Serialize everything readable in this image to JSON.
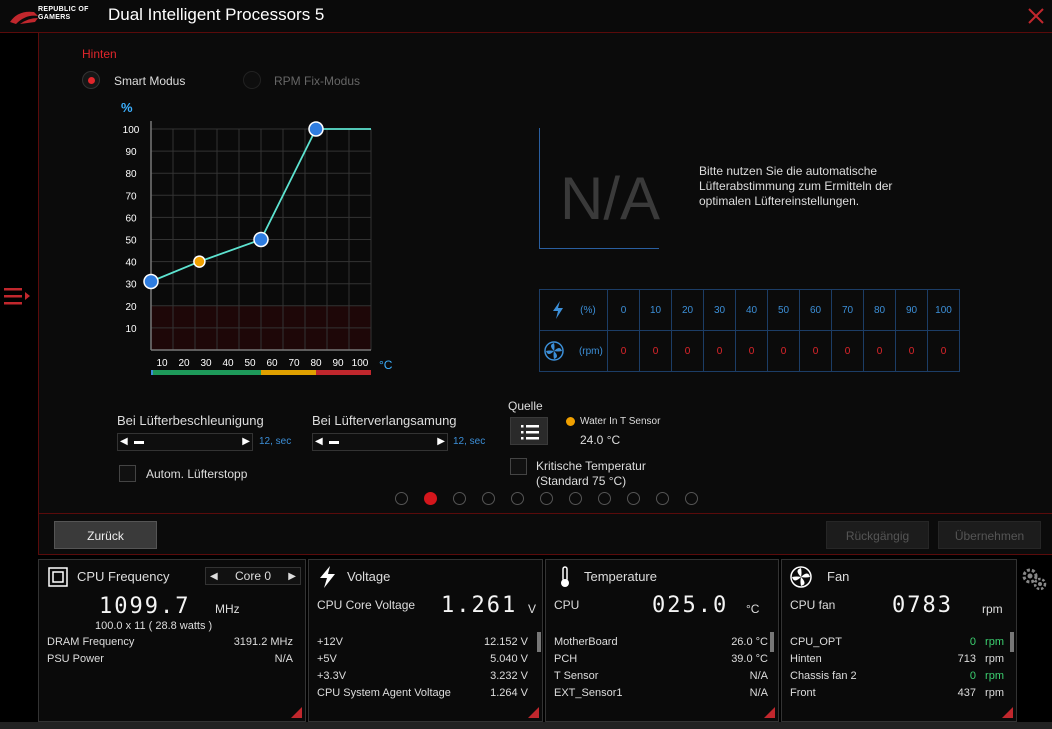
{
  "app": {
    "title": "Dual Intelligent Processors 5",
    "logo_line1": "REPUBLIC OF",
    "logo_line2": "GAMERS"
  },
  "fan_section": {
    "title": "Hinten",
    "mode_smart": "Smart Modus",
    "mode_rpm": "RPM Fix-Modus",
    "selected_mode": "Smart Modus",
    "y_unit": "%",
    "x_unit": "°C",
    "na_value": "N/A",
    "na_hint": "Bitte nutzen Sie die automatische Lüfterabstimmung zum Ermitteln der optimalen Lüftereinstellungen.",
    "table_pct_unit": "(%)",
    "table_rpm_unit": "(rpm)",
    "table_pct": [
      "0",
      "10",
      "20",
      "30",
      "40",
      "50",
      "60",
      "70",
      "80",
      "90",
      "100"
    ],
    "table_rpm": [
      "0",
      "0",
      "0",
      "0",
      "0",
      "0",
      "0",
      "0",
      "0",
      "0",
      "0"
    ],
    "accel_label": "Bei Lüfterbeschleunigung",
    "accel_value": "12, sec",
    "decel_label": "Bei Lüfterverlangsamung",
    "decel_value": "12, sec",
    "auto_stop_label": "Autom. Lüfterstopp",
    "source_label": "Quelle",
    "sensor_name": "Water In T Sensor",
    "sensor_temp": "24.0 °C",
    "critical_label": "Kritische Temperatur",
    "critical_sub": "(Standard 75 °C)",
    "pages": 11,
    "active_page": 2,
    "btn_back": "Zurück",
    "btn_undo": "Rückgängig",
    "btn_apply": "Übernehmen"
  },
  "chart_data": {
    "type": "line",
    "x": [
      0,
      22,
      50,
      75,
      100
    ],
    "y": [
      31,
      40,
      50,
      100,
      100
    ],
    "control_points": [
      {
        "x": 0,
        "y": 31,
        "color": "#2f7de0"
      },
      {
        "x": 22,
        "y": 40,
        "color": "#f0a000"
      },
      {
        "x": 50,
        "y": 50,
        "color": "#2f7de0"
      },
      {
        "x": 75,
        "y": 100,
        "color": "#2f7de0"
      }
    ],
    "xticks": [
      "10",
      "20",
      "30",
      "40",
      "50",
      "60",
      "70",
      "80",
      "90",
      "100"
    ],
    "yticks": [
      "10",
      "20",
      "30",
      "40",
      "50",
      "60",
      "70",
      "80",
      "90",
      "100"
    ],
    "xlim": [
      0,
      100
    ],
    "ylim": [
      0,
      100
    ],
    "line_color": "#5de3d0",
    "zone_colors": [
      "#1e9a5a",
      "#e0a000",
      "#c1272d"
    ]
  },
  "bottom": {
    "cpu": {
      "title": "CPU Frequency",
      "core": "Core 0",
      "value": "1099.7",
      "unit": "MHz",
      "formula": "100.0  x  11     ( 28.8 watts )",
      "rows": [
        {
          "label": "DRAM Frequency",
          "value": "3191.2  MHz"
        },
        {
          "label": "PSU Power",
          "value": "N/A"
        }
      ]
    },
    "voltage": {
      "title": "Voltage",
      "main_label": "CPU Core Voltage",
      "value": "1.261",
      "unit": "V",
      "rows": [
        {
          "label": "+12V",
          "value": "12.152  V"
        },
        {
          "label": "+5V",
          "value": "5.040  V"
        },
        {
          "label": "+3.3V",
          "value": "3.232  V"
        },
        {
          "label": "CPU System Agent Voltage",
          "value": "1.264  V"
        }
      ]
    },
    "temperature": {
      "title": "Temperature",
      "main_label": "CPU",
      "value": "025.0",
      "unit": "°C",
      "rows": [
        {
          "label": "MotherBoard",
          "value": "26.0 °C"
        },
        {
          "label": "PCH",
          "value": "39.0 °C"
        },
        {
          "label": "T Sensor",
          "value": "N/A"
        },
        {
          "label": "EXT_Sensor1",
          "value": "N/A"
        }
      ]
    },
    "fan": {
      "title": "Fan",
      "main_label": "CPU fan",
      "value": "0783",
      "unit": "rpm",
      "rows": [
        {
          "label": "CPU_OPT",
          "value": "0",
          "unit": "rpm",
          "green": true
        },
        {
          "label": "Hinten",
          "value": "713",
          "unit": "rpm",
          "green": false
        },
        {
          "label": "Chassis fan 2",
          "value": "0",
          "unit": "rpm",
          "green": true
        },
        {
          "label": "Front",
          "value": "437",
          "unit": "rpm",
          "green": false
        }
      ]
    }
  }
}
